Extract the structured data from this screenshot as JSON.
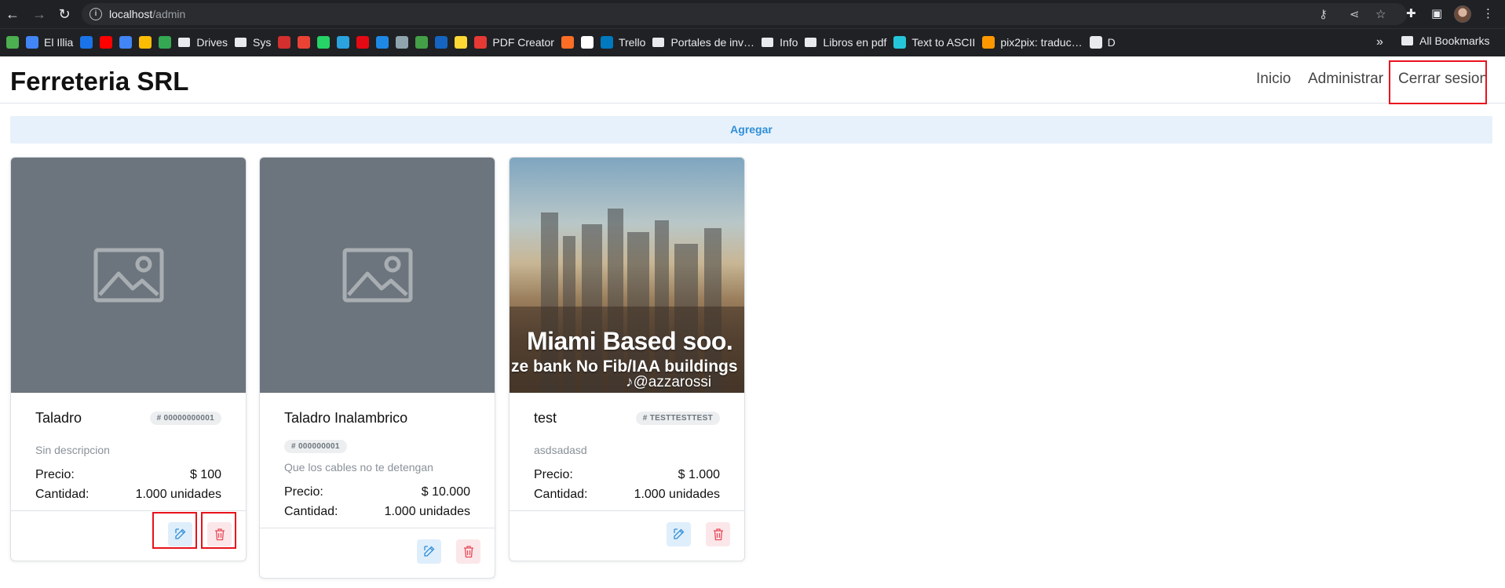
{
  "browser": {
    "url_host": "localhost",
    "url_path": "/admin",
    "bookmarks": [
      {
        "label": "",
        "icon": "app-icon",
        "color": "#4caf50"
      },
      {
        "label": "El Illia",
        "icon": "site-icon",
        "color": "#4285f4"
      },
      {
        "label": "",
        "icon": "calendar-icon",
        "color": "#1a73e8"
      },
      {
        "label": "",
        "icon": "youtube-icon",
        "color": "#ff0000"
      },
      {
        "label": "",
        "icon": "translate-icon",
        "color": "#4285f4"
      },
      {
        "label": "",
        "icon": "photos-icon",
        "color": "#fbbc04"
      },
      {
        "label": "",
        "icon": "drive-icon",
        "color": "#34a853"
      },
      {
        "label": "Drives",
        "icon": "folder-icon",
        "color": "#e8eaed"
      },
      {
        "label": "Sys",
        "icon": "folder-icon",
        "color": "#e8eaed"
      },
      {
        "label": "",
        "icon": "star-icon",
        "color": "#d32f2f"
      },
      {
        "label": "",
        "icon": "gmail-icon",
        "color": "#ea4335"
      },
      {
        "label": "",
        "icon": "whatsapp-icon",
        "color": "#25d366"
      },
      {
        "label": "",
        "icon": "telegram-icon",
        "color": "#2aa3df"
      },
      {
        "label": "",
        "icon": "netflix-icon",
        "color": "#e50914"
      },
      {
        "label": "",
        "icon": "play-icon",
        "color": "#1e88e5"
      },
      {
        "label": "",
        "icon": "tool-icon",
        "color": "#90a4ae"
      },
      {
        "label": "",
        "icon": "doc-icon",
        "color": "#43a047"
      },
      {
        "label": "",
        "icon": "html-icon",
        "color": "#1565c0"
      },
      {
        "label": "",
        "icon": "image-icon",
        "color": "#fdd835"
      },
      {
        "label": "PDF Creator",
        "icon": "pdf-icon",
        "color": "#e53935"
      },
      {
        "label": "",
        "icon": "gitlab-icon",
        "color": "#fc6d26"
      },
      {
        "label": "",
        "icon": "x-icon",
        "color": "#ffffff"
      },
      {
        "label": "Trello",
        "icon": "trello-icon",
        "color": "#0079bf"
      },
      {
        "label": "Portales de inv…",
        "icon": "folder-icon",
        "color": "#e8eaed"
      },
      {
        "label": "Info",
        "icon": "folder-icon",
        "color": "#e8eaed"
      },
      {
        "label": "Libros en pdf",
        "icon": "folder-icon",
        "color": "#e8eaed"
      },
      {
        "label": "Text to ASCII",
        "icon": "ascii-icon",
        "color": "#26c6da"
      },
      {
        "label": "pix2pix: traduc…",
        "icon": "hf-icon",
        "color": "#ff9800"
      },
      {
        "label": "D",
        "icon": "globe-icon",
        "color": "#e8eaed"
      }
    ],
    "more_label": "»",
    "all_bookmarks_label": "All Bookmarks"
  },
  "navbar": {
    "brand": "Ferreteria SRL",
    "links": [
      "Inicio",
      "Administrar",
      "Cerrar sesion"
    ]
  },
  "agregar_label": "Agregar",
  "labels": {
    "price": "Precio:",
    "quantity": "Cantidad:"
  },
  "products": [
    {
      "name": "Taladro",
      "code": "# 00000000001",
      "description": "Sin descripcion",
      "price": "$ 100",
      "quantity": "1.000 unidades",
      "image": "placeholder"
    },
    {
      "name": "Taladro Inalambrico",
      "code": "# 000000001",
      "description": "Que los cables no te detengan",
      "price": "$ 10.000",
      "quantity": "1.000 unidades",
      "image": "placeholder"
    },
    {
      "name": "test",
      "code": "# TESTTESTTEST",
      "description": "asdsadasd",
      "price": "$ 1.000",
      "quantity": "1.000 unidades",
      "image": "photo",
      "image_caption": [
        "Miami Based soo.",
        "ze bank No Fib/IAA  buildings",
        "@azzarossi"
      ]
    }
  ],
  "colors": {
    "highlight": "#e8121c",
    "accent": "#2f8fd8",
    "danger": "#e84b5a"
  }
}
